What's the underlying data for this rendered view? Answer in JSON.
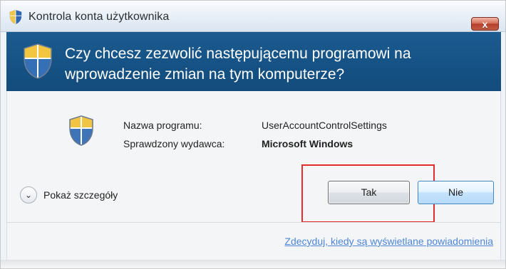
{
  "window": {
    "title": "Kontrola konta użytkownika",
    "close_label": "x"
  },
  "banner": {
    "question": "Czy chcesz zezwolić następującemu programowi na wprowadzenie zmian na tym komputerze?"
  },
  "program": {
    "name_label": "Nazwa programu:",
    "name_value": "UserAccountControlSettings",
    "publisher_label": "Sprawdzony wydawca:",
    "publisher_value": "Microsoft Windows"
  },
  "actions": {
    "details_label": "Pokaż szczegóły",
    "yes_label": "Tak",
    "no_label": "Nie",
    "notifications_link": "Zdecyduj, kiedy są wyświetlane powiadomienia"
  },
  "icons": {
    "title_icon": "shield-icon",
    "banner_icon": "shield-icon",
    "program_icon": "shield-icon",
    "details_icon": "chevron-down-icon"
  },
  "colors": {
    "banner": "#155184",
    "highlight": "#e32d2d",
    "link": "#4d86d7"
  }
}
